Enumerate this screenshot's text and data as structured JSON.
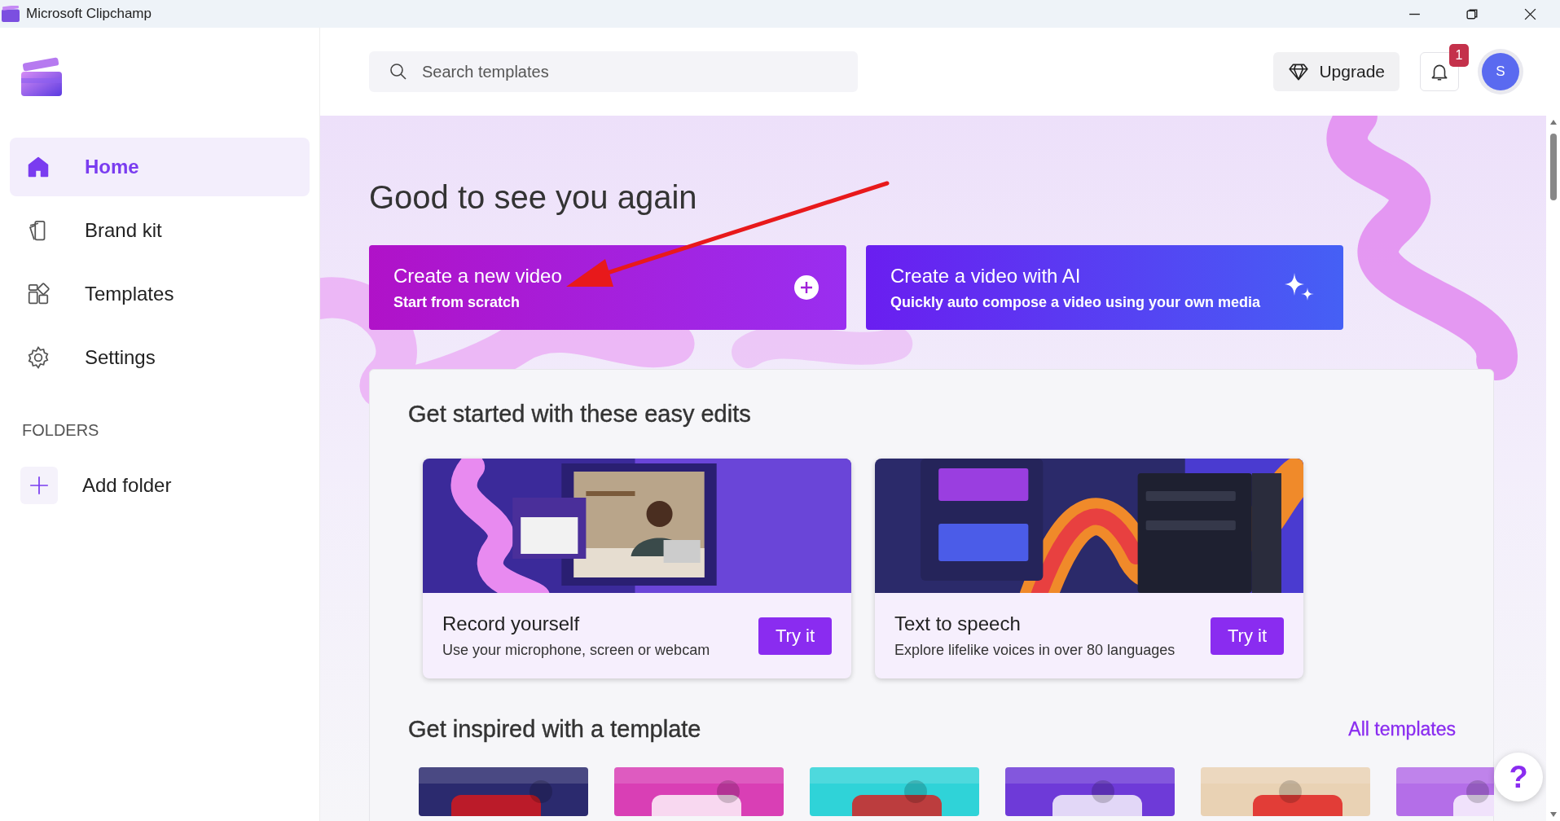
{
  "window": {
    "title": "Microsoft Clipchamp"
  },
  "sidebar": {
    "items": [
      {
        "kind": "home",
        "label": "Home",
        "selected": true
      },
      {
        "kind": "brand",
        "label": "Brand kit",
        "selected": false
      },
      {
        "kind": "templates",
        "label": "Templates",
        "selected": false
      },
      {
        "kind": "settings",
        "label": "Settings",
        "selected": false
      }
    ],
    "folders_heading": "FOLDERS",
    "add_folder": "Add folder"
  },
  "search": {
    "placeholder": "Search templates"
  },
  "upgrade": "Upgrade",
  "notifications": {
    "count": "1"
  },
  "avatar": "S",
  "greeting": "Good to see you again",
  "actions": [
    {
      "kind": "new",
      "title": "Create a new video",
      "subtitle": "Start from scratch"
    },
    {
      "kind": "ai",
      "title": "Create a video with AI",
      "subtitle": "Quickly auto compose a video using your own media"
    }
  ],
  "easy_edits": {
    "heading": "Get started with these easy edits",
    "cards": [
      {
        "kind": "record",
        "title": "Record yourself",
        "description": "Use your microphone, screen or webcam",
        "button": "Try it"
      },
      {
        "kind": "speech",
        "title": "Text to speech",
        "description": "Explore lifelike voices in over 80 languages",
        "button": "Try it"
      }
    ]
  },
  "templates": {
    "heading": "Get inspired with a template",
    "link": "All templates"
  },
  "help": "?"
}
